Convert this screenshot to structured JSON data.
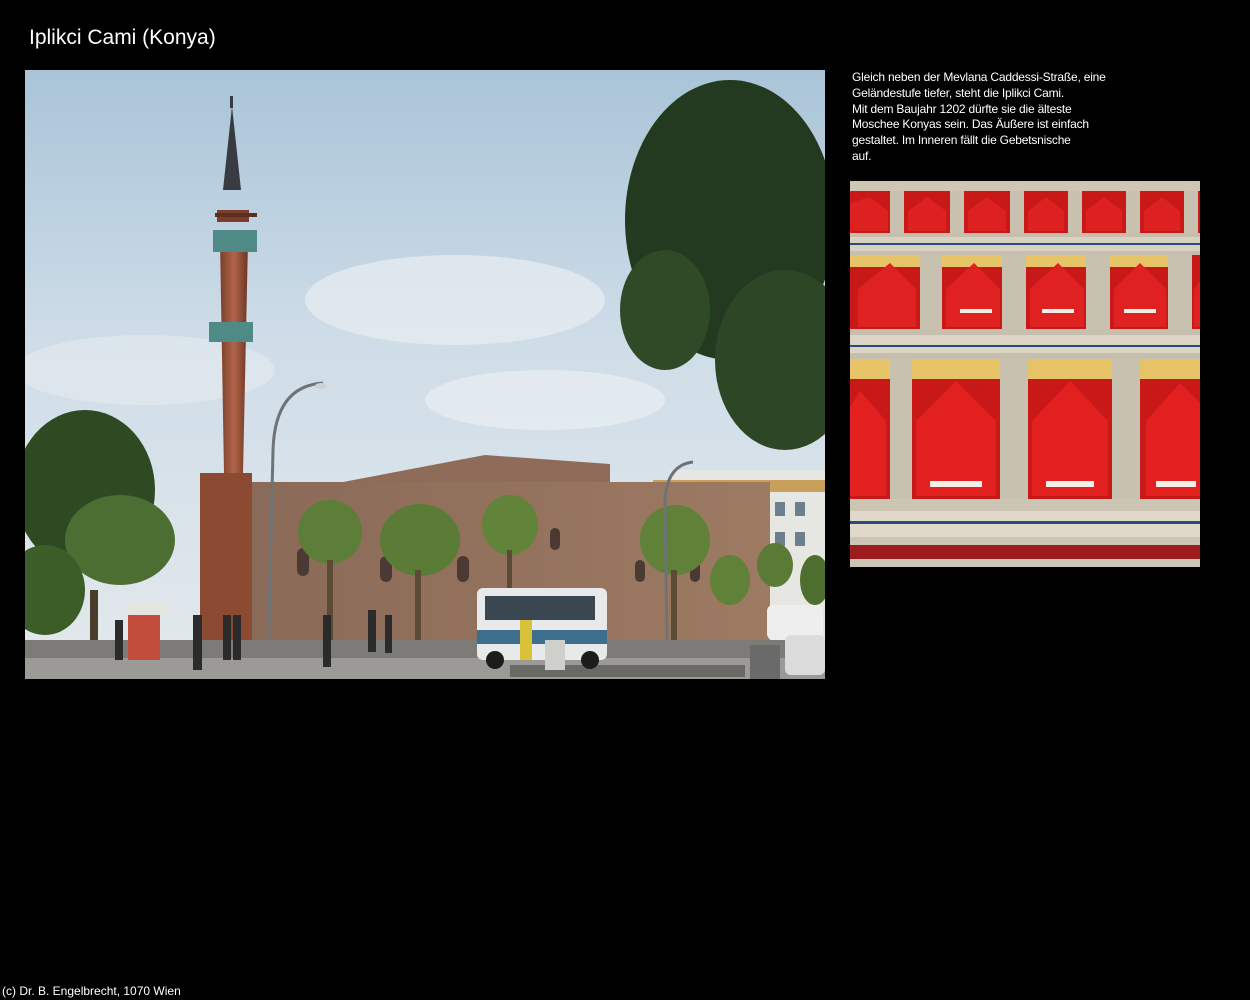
{
  "page": {
    "title": "Iplikci Cami (Konya)"
  },
  "main_photo": {
    "subject": "mosque-with-minaret-street-scene"
  },
  "description": {
    "lines": [
      "Gleich neben der Mevlana Caddessi-Straße, eine",
      "Geländestufe tiefer, steht die Iplikci Cami.",
      "Mit dem Baujahr 1202 dürfte sie die älteste",
      "Moschee Konyas sein. Das Äußere ist einfach",
      "gestaltet. Im Inneren fällt die Gebetsnische",
      "auf."
    ]
  },
  "carpet_photo": {
    "subject": "red-prayer-carpet"
  },
  "footer": {
    "copyright": "(c) Dr. B. Engelbrecht, 1070 Wien"
  },
  "colors": {
    "background": "#000000",
    "text": "#ffffff",
    "carpet_red": "#d81d1d",
    "sky": "#cfdde8",
    "brick": "#a45c42"
  }
}
